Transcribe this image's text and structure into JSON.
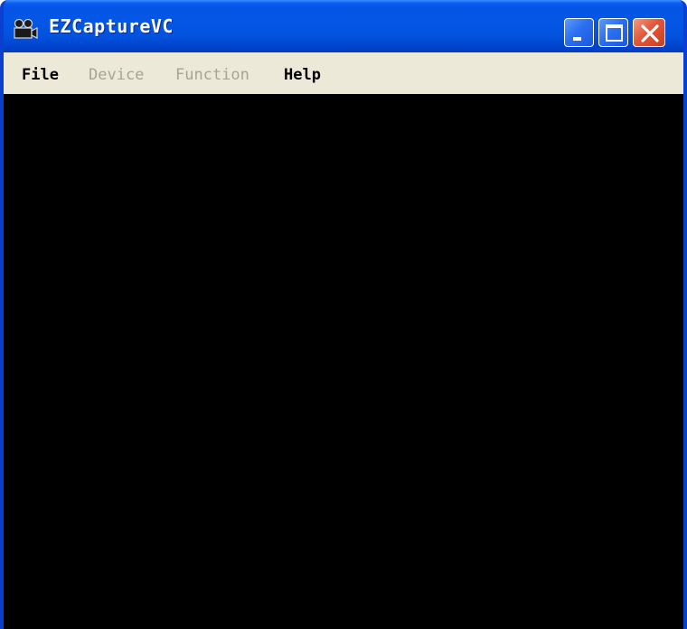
{
  "window": {
    "title": "EZCaptureVC",
    "icon": "camera-projector-icon"
  },
  "title_buttons": {
    "minimize": "minimize-icon",
    "maximize": "maximize-icon",
    "close": "close-icon"
  },
  "menu": {
    "items": [
      {
        "label": "File",
        "enabled": true
      },
      {
        "label": "Device",
        "enabled": false
      },
      {
        "label": "Function",
        "enabled": false
      },
      {
        "label": "Help",
        "enabled": true
      }
    ]
  },
  "colors": {
    "titlebar": "#0554e6",
    "menubar": "#ece9d8",
    "client": "#000000",
    "disabled_text": "#a7a497",
    "close_button": "#e2573a"
  }
}
